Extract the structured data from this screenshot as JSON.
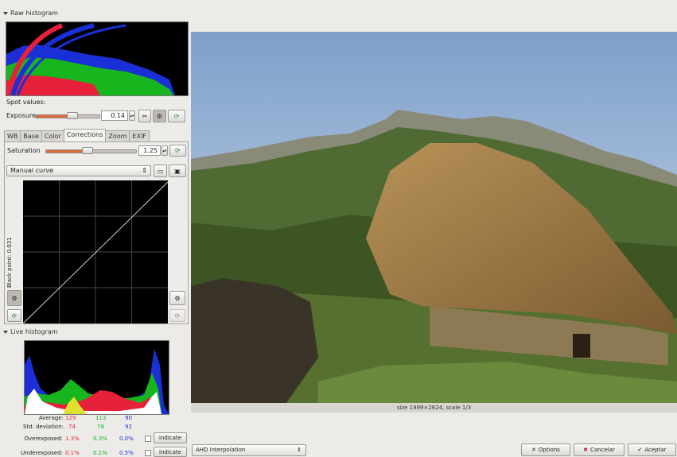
{
  "raw_histogram": {
    "title": "Raw histogram"
  },
  "spot_values": {
    "label": "Spot values:"
  },
  "exposure": {
    "label": "Exposure",
    "value": "0.14",
    "level": 0.48
  },
  "tabs": [
    {
      "label": "WB",
      "active": false
    },
    {
      "label": "Base",
      "active": false
    },
    {
      "label": "Color",
      "active": false
    },
    {
      "label": "Corrections",
      "active": true
    },
    {
      "label": "Zoom",
      "active": false
    },
    {
      "label": "EXIF",
      "active": false
    }
  ],
  "saturation": {
    "label": "Saturation",
    "value": "1.25",
    "level": 0.42
  },
  "curve": {
    "selected": "Manual curve",
    "black_point_label": "Black point: 0.031"
  },
  "live_histogram": {
    "title": "Live histogram",
    "average": {
      "label": "Average:",
      "r": "129",
      "g": "113",
      "b": "90"
    },
    "std_dev": {
      "label": "Std. deviation:",
      "r": "74",
      "g": "78",
      "b": "92"
    },
    "overexposed": {
      "label": "Overexposed:",
      "r": "1.3%",
      "g": "0.3%",
      "b": "0.0%",
      "indicate": "indicate"
    },
    "underexposed": {
      "label": "Underexposed:",
      "r": "0.1%",
      "g": "0.1%",
      "b": "0.5%",
      "indicate": "indicate"
    }
  },
  "image_status": "size 1999×2624, scale 1/3",
  "interpolation": {
    "selected": "AHD interpolation"
  },
  "buttons": {
    "options": "Options",
    "cancel": "Cancelar",
    "accept": "Aceptar"
  },
  "colors": {
    "red": "#e8213a",
    "green": "#17b51e",
    "blue": "#1a2fd6",
    "accent": "#e06a3b"
  }
}
